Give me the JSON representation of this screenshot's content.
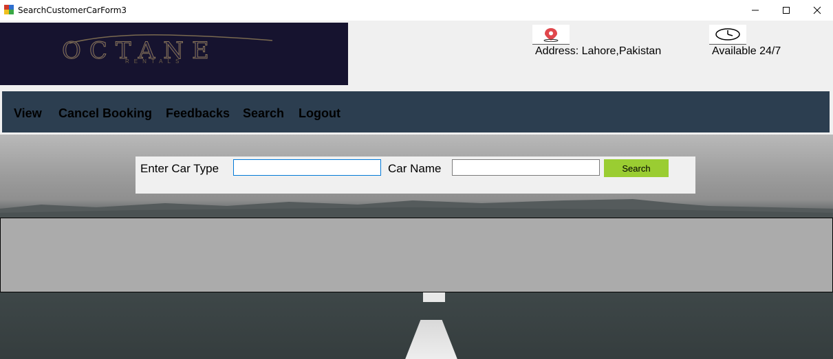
{
  "window": {
    "title": "SearchCustomerCarForm3"
  },
  "header": {
    "logo_text": "OCTANE",
    "logo_subtext": "RENTALS",
    "address": "Address: Lahore,Pakistan",
    "availability": "Available 24/7",
    "colors": {
      "logo_bg": "#16132f",
      "nav_bg": "#2c3e50",
      "accent_button": "#9acd32"
    }
  },
  "nav": {
    "items": [
      {
        "label": "View"
      },
      {
        "label": "Cancel Booking"
      },
      {
        "label": "Feedbacks"
      },
      {
        "label": "Search"
      },
      {
        "label": "Logout"
      }
    ]
  },
  "search": {
    "car_type_label": "Enter Car Type",
    "car_type_value": "",
    "car_name_label": "Car Name",
    "car_name_value": "",
    "button_label": "Search"
  },
  "icons": {
    "location": "map-pin-icon",
    "clock": "clock-icon"
  }
}
